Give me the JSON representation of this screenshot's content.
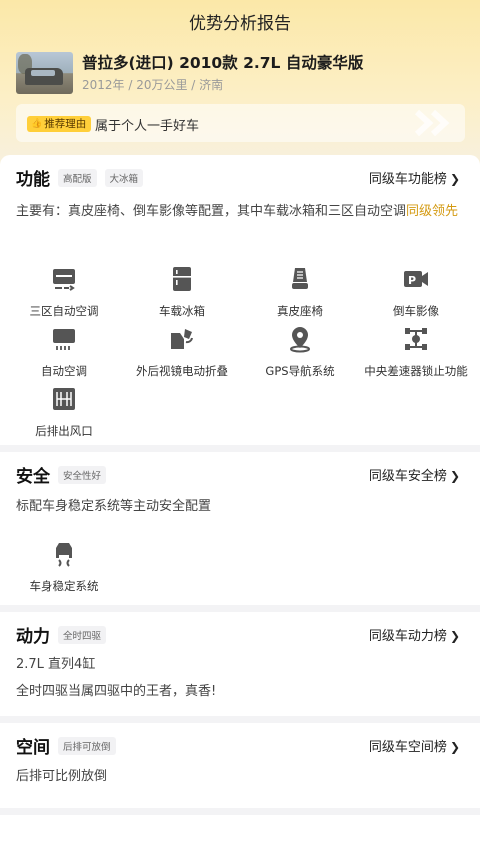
{
  "header": {
    "title": "优势分析报告"
  },
  "car": {
    "name": "普拉多(进口) 2010款 2.7L 自动豪华版",
    "meta": "2012年 / 20万公里 / 济南"
  },
  "reason": {
    "tag": "推荐理由",
    "text": "属于个人一手好车"
  },
  "sections": {
    "function": {
      "title": "功能",
      "tags": [
        "高配版",
        "大冰箱"
      ],
      "rank_link": "同级车功能榜",
      "desc_main": "主要有：真皮座椅、倒车影像等配置，其中车载冰箱和三区自动空调",
      "desc_highlight": "同级领先",
      "features": [
        {
          "label": "三区自动空调",
          "icon": "tri-zone-ac-icon"
        },
        {
          "label": "车载冰箱",
          "icon": "fridge-icon"
        },
        {
          "label": "真皮座椅",
          "icon": "leather-seat-icon"
        },
        {
          "label": "倒车影像",
          "icon": "reverse-camera-icon"
        },
        {
          "label": "自动空调",
          "icon": "auto-ac-icon"
        },
        {
          "label": "外后视镜电动折叠",
          "icon": "mirror-fold-icon"
        },
        {
          "label": "GPS导航系统",
          "icon": "gps-icon"
        },
        {
          "label": "中央差速器锁止功能",
          "icon": "diff-lock-icon"
        },
        {
          "label": "后排出风口",
          "icon": "rear-vent-icon"
        }
      ]
    },
    "safety": {
      "title": "安全",
      "tags": [
        "安全性好"
      ],
      "rank_link": "同级车安全榜",
      "desc": "标配车身稳定系统等主动安全配置",
      "features": [
        {
          "label": "车身稳定系统",
          "icon": "stability-control-icon"
        }
      ]
    },
    "power": {
      "title": "动力",
      "tags": [
        "全时四驱"
      ],
      "rank_link": "同级车动力榜",
      "line1": "2.7L 直列4缸",
      "line2": "全时四驱当属四驱中的王者，真香!"
    },
    "space": {
      "title": "空间",
      "tags": [
        "后排可放倒"
      ],
      "rank_link": "同级车空间榜",
      "desc": "后排可比例放倒"
    }
  }
}
